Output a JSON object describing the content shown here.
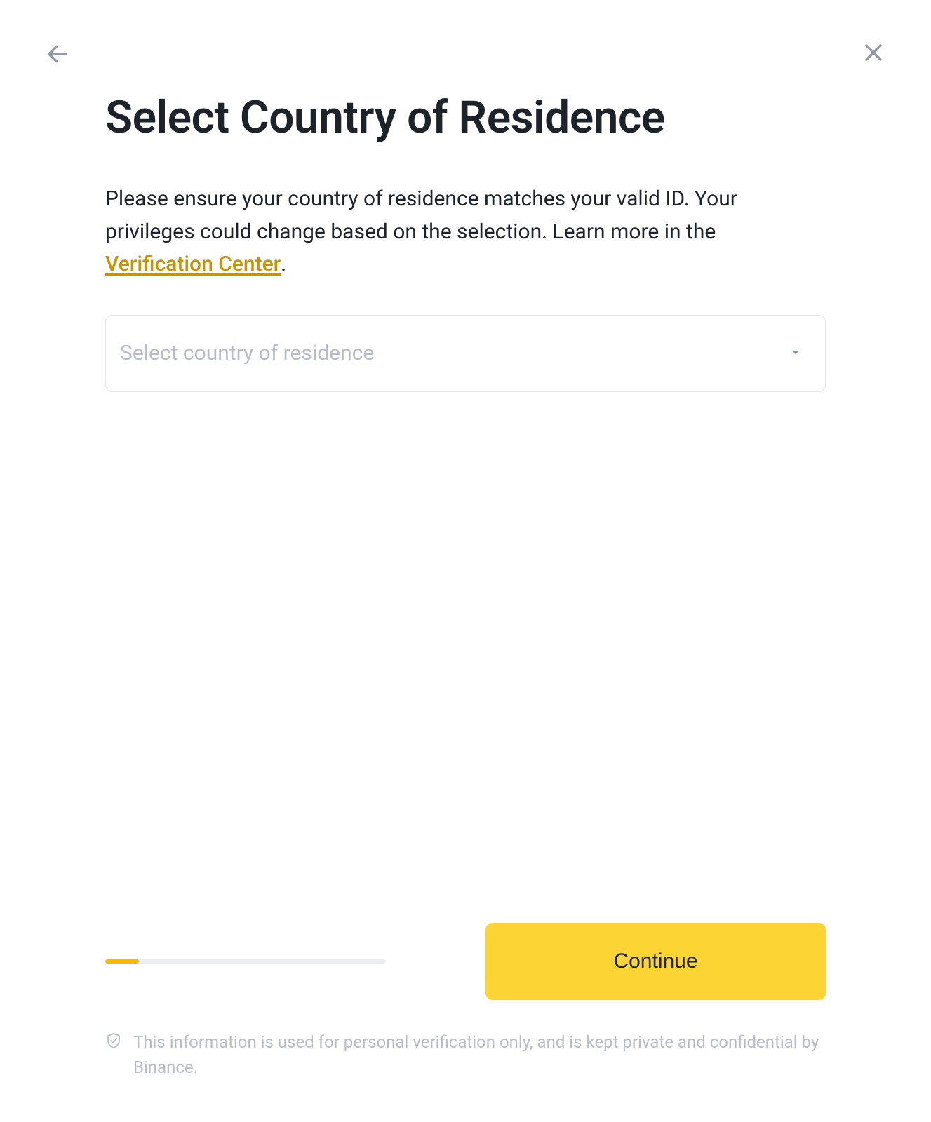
{
  "header": {
    "title": "Select Country of Residence"
  },
  "description": {
    "text_prefix": "Please ensure your country of residence matches your valid ID. Your privileges could change based on the selection. Learn more in the ",
    "link_text": "Verification Center",
    "text_suffix": "."
  },
  "select": {
    "placeholder": "Select country of residence"
  },
  "progress": {
    "percent": 12
  },
  "actions": {
    "continue_label": "Continue"
  },
  "privacy": {
    "text": "This information is used for personal verification only, and is kept private and confidential by Binance."
  },
  "colors": {
    "accent": "#fcd535",
    "link": "#c99400",
    "text_primary": "#1e2329",
    "text_muted": "#b7bdc6",
    "border": "#e5e5e5"
  }
}
